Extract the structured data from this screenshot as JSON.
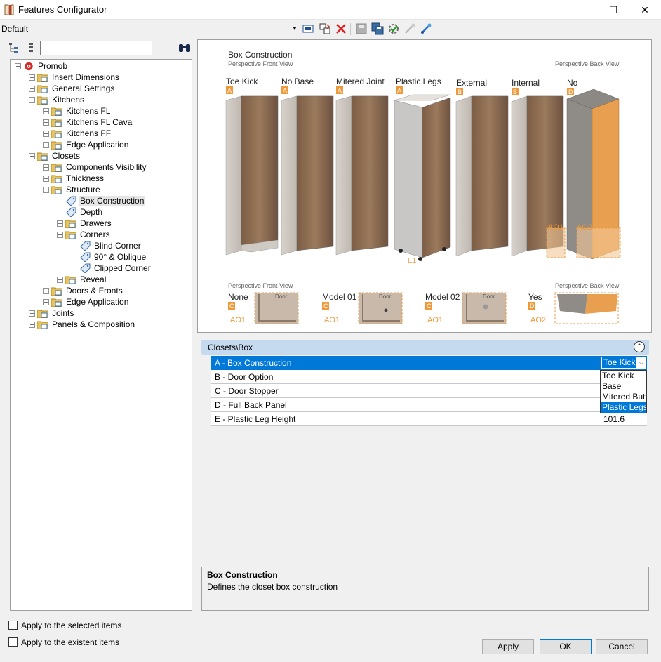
{
  "window": {
    "title": "Features Configurator",
    "minimize": "—",
    "maximize": "☐",
    "close": "✕"
  },
  "toolbar": {
    "profile": "Default"
  },
  "search": {
    "value": ""
  },
  "tree": {
    "nodes": [
      {
        "label": "Promob"
      },
      {
        "label": "Insert Dimensions"
      },
      {
        "label": "General Settings"
      },
      {
        "label": "Kitchens"
      },
      {
        "label": "Kitchens FL"
      },
      {
        "label": "Kitchens FL Cava"
      },
      {
        "label": "Kitchens FF"
      },
      {
        "label": "Edge Application"
      },
      {
        "label": "Closets"
      },
      {
        "label": "Components Visibility"
      },
      {
        "label": "Thickness"
      },
      {
        "label": "Structure"
      },
      {
        "label": "Box Construction"
      },
      {
        "label": "Depth"
      },
      {
        "label": "Drawers"
      },
      {
        "label": "Corners"
      },
      {
        "label": "Blind Corner"
      },
      {
        "label": "90° & Oblique"
      },
      {
        "label": "Clipped Corner"
      },
      {
        "label": "Reveal"
      },
      {
        "label": "Doors & Fronts"
      },
      {
        "label": "Edge Application"
      },
      {
        "label": "Joints"
      },
      {
        "label": "Panels & Composition"
      }
    ]
  },
  "options": {
    "apply_selected": "Apply to the selected items",
    "apply_existent": "Apply to the existent items"
  },
  "diagram": {
    "title": "Box Construction",
    "front_view": "Perspective Front View",
    "back_view": "Perspective Back View",
    "cabinets": [
      {
        "label": "Toe Kick",
        "letter": "A"
      },
      {
        "label": "No Base",
        "letter": "A"
      },
      {
        "label": "Mitered Joint",
        "letter": "A"
      },
      {
        "label": "Plastic Legs",
        "letter": "A"
      },
      {
        "label": "External",
        "letter": "B"
      },
      {
        "label": "Internal",
        "letter": "B"
      },
      {
        "label": "No",
        "letter": "D"
      }
    ],
    "ao1": "AO1",
    "ao2": "AO2",
    "e1": "E1",
    "bottom_front_view": "Perspective Front View",
    "bottom_back_view": "Perspective Back View",
    "bottom_items": [
      {
        "label": "None",
        "letter": "C",
        "code": "AO1"
      },
      {
        "label": "Model 01",
        "letter": "C",
        "code": "AO1",
        "door": "Door"
      },
      {
        "label": "Model 02",
        "letter": "C",
        "code": "AO1",
        "door": "Door"
      },
      {
        "label": "Yes",
        "letter": "D",
        "code": "AO2"
      }
    ],
    "none_door": "Door"
  },
  "properties": {
    "path": "Closets\\Box",
    "collapse": "⌃",
    "rows": [
      {
        "name": "A - Box Construction",
        "value": "Toe Kick"
      },
      {
        "name": "B - Door Option",
        "value": ""
      },
      {
        "name": "C - Door Stopper",
        "value": ""
      },
      {
        "name": "D - Full Back Panel",
        "value": ""
      },
      {
        "name": "E - Plastic Leg Height",
        "value": "101.6"
      }
    ],
    "dropdown": [
      "Toe Kick",
      "Base",
      "Mitered Butt",
      "Plastic Legs"
    ]
  },
  "description": {
    "title": "Box Construction",
    "text": "Defines the closet box construction"
  },
  "buttons": {
    "apply": "Apply",
    "ok": "OK",
    "cancel": "Cancel"
  },
  "colors": {
    "accent": "#0078d7",
    "orange": "#ee9a3b",
    "wood": "#8a6a4f",
    "gray": "#cfc8c2"
  }
}
